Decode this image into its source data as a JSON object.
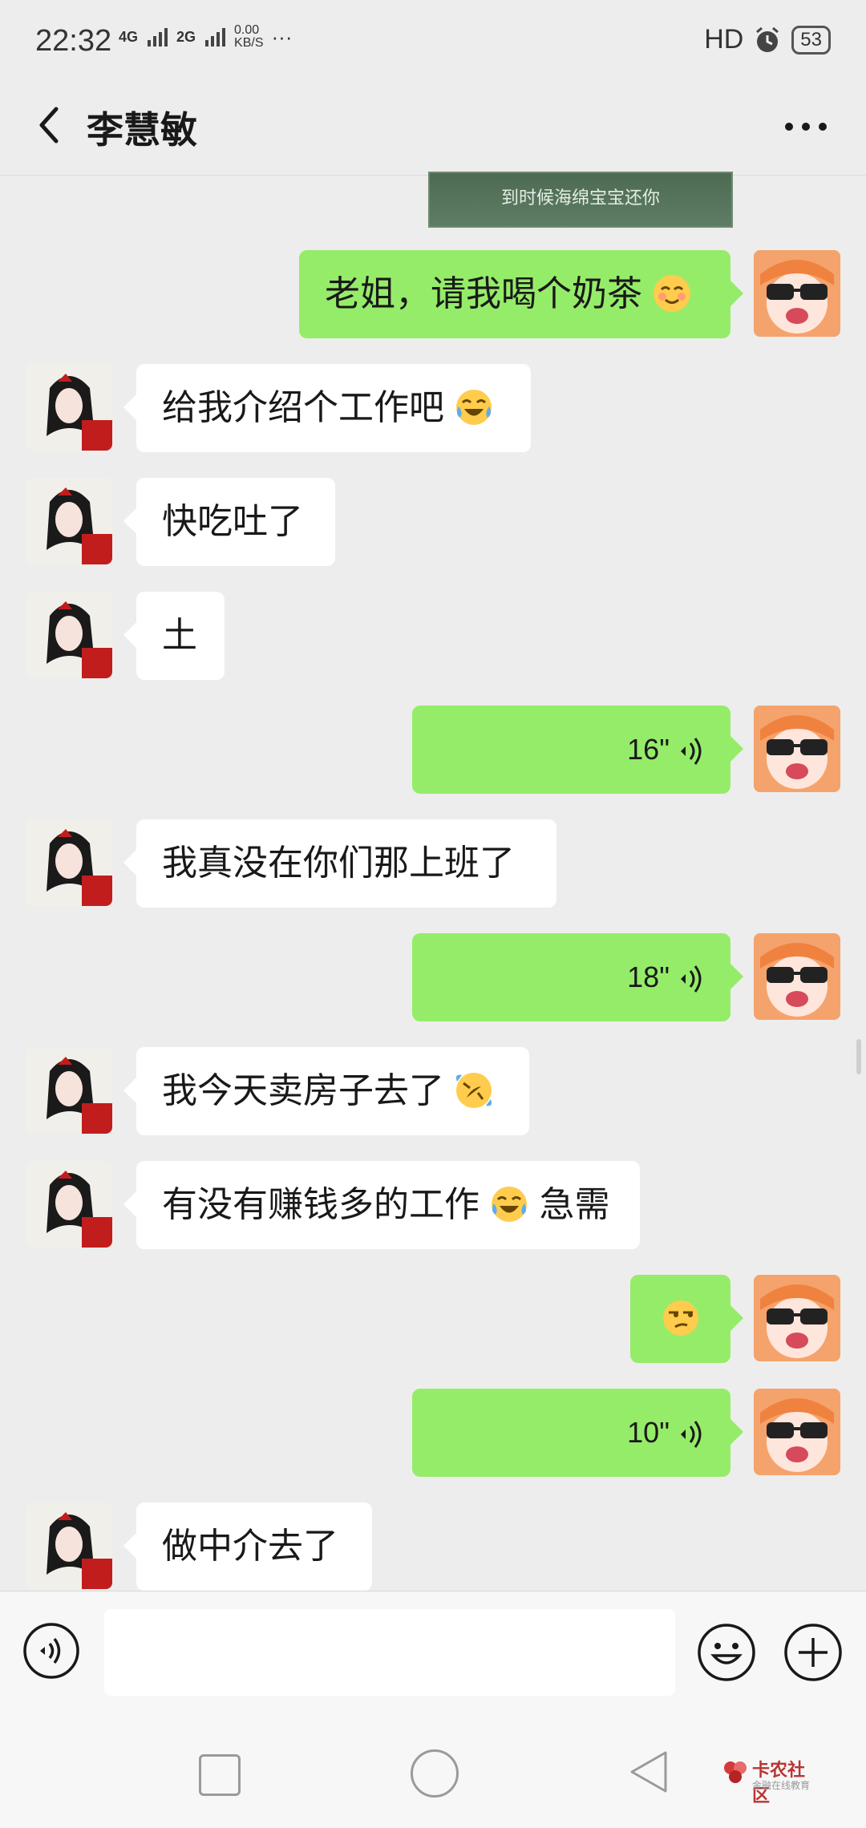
{
  "status_bar": {
    "time": "22:32",
    "network_1": "4G",
    "network_2": "2G",
    "speed": "0.00\nKB/S",
    "more": "···",
    "hd": "HD",
    "battery": "53"
  },
  "header": {
    "title": "李慧敏"
  },
  "chat": {
    "image_caption": "到时候海绵宝宝还你",
    "messages": [
      {
        "side": "right",
        "text": "老姐，请我喝个奶茶",
        "emoji": "blush"
      },
      {
        "side": "left",
        "text": "给我介绍个工作吧",
        "emoji": "tears-of-joy"
      },
      {
        "side": "left",
        "text": "快吃吐了"
      },
      {
        "side": "left",
        "text": "土"
      },
      {
        "side": "right",
        "voice": "16\""
      },
      {
        "side": "left",
        "text": "我真没在你们那上班了"
      },
      {
        "side": "right",
        "voice": "18\""
      },
      {
        "side": "left",
        "text": "我今天卖房子去了",
        "emoji": "rolling-laughing"
      },
      {
        "side": "left",
        "text": "有没有赚钱多的工作",
        "emoji": "tears-of-joy",
        "text2": "急需"
      },
      {
        "side": "right",
        "emoji_only": "unamused"
      },
      {
        "side": "right",
        "voice": "10\""
      },
      {
        "side": "left",
        "text": "做中介去了"
      }
    ]
  },
  "input": {
    "placeholder": ""
  },
  "watermark": {
    "title": "卡农社区",
    "subtitle": "金融在线教育"
  },
  "colors": {
    "sent_bubble": "#95ec69",
    "received_bubble": "#ffffff",
    "background": "#ededed"
  }
}
